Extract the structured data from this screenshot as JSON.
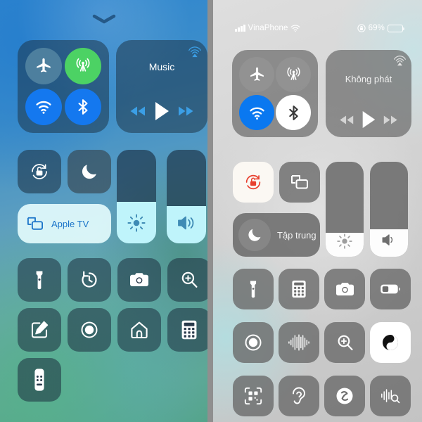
{
  "left_panel": {
    "name": "ios-control-center-light-wallpaper",
    "handle": {
      "icon": "chevron-down-icon"
    },
    "connectivity": {
      "airplane": {
        "label": "Airplane Mode",
        "icon": "airplane-icon",
        "state": "off",
        "color": "#4d7f9e"
      },
      "cellular": {
        "label": "Cellular Data",
        "icon": "cellular-icon",
        "state": "on",
        "color": "#4cd264"
      },
      "wifi": {
        "label": "Wi-Fi",
        "icon": "wifi-icon",
        "state": "on",
        "color": "#1478ef"
      },
      "bluetooth": {
        "label": "Bluetooth",
        "icon": "bluetooth-icon",
        "state": "on",
        "color": "#1478ef"
      }
    },
    "media": {
      "title": "Music",
      "airplay_icon": "airplay-audio-icon",
      "prev_icon": "rewind-icon",
      "play_icon": "play-icon",
      "next_icon": "fast-forward-icon",
      "accent": "#38a0e8"
    },
    "rotation_lock": {
      "label": "Rotation Lock",
      "icon": "rotation-lock-icon",
      "state": "off"
    },
    "do_not_disturb": {
      "label": "Do Not Disturb",
      "icon": "moon-icon",
      "state": "off"
    },
    "screen_mirroring": {
      "label": "Apple TV",
      "icon": "screen-mirroring-icon",
      "state": "on",
      "text_color": "#1a74c9"
    },
    "brightness": {
      "label": "Brightness",
      "icon": "brightness-icon",
      "value_percent": 44
    },
    "volume": {
      "label": "Volume",
      "icon": "speaker-icon",
      "value_percent": 40
    },
    "shortcuts": [
      {
        "label": "Flashlight",
        "icon": "flashlight-icon"
      },
      {
        "label": "Timer",
        "icon": "timer-icon"
      },
      {
        "label": "Camera",
        "icon": "camera-icon"
      },
      {
        "label": "Magnifier",
        "icon": "magnifier-icon"
      },
      {
        "label": "Notes",
        "icon": "notes-icon"
      },
      {
        "label": "Screen Recording",
        "icon": "screen-record-icon"
      },
      {
        "label": "Home",
        "icon": "home-icon"
      },
      {
        "label": "Calculator",
        "icon": "calculator-icon"
      },
      {
        "label": "Apple TV Remote",
        "icon": "remote-icon"
      }
    ]
  },
  "right_panel": {
    "name": "ios-control-center-dark-wallpaper",
    "status_bar": {
      "signal_icon": "signal-bars-icon",
      "carrier": "VinaPhone",
      "wifi_icon": "wifi-icon",
      "lock_icon": "rotation-lock-status-icon",
      "battery_percent": "69%",
      "battery_icon": "battery-icon",
      "battery_fill": 69
    },
    "connectivity": {
      "airplane": {
        "label": "Airplane Mode",
        "icon": "airplane-icon",
        "state": "off",
        "color": "#8b8b8b"
      },
      "cellular": {
        "label": "Cellular Data",
        "icon": "cellular-icon",
        "state": "off",
        "color": "#8b8b8b"
      },
      "wifi": {
        "label": "Wi-Fi",
        "icon": "wifi-icon",
        "state": "on",
        "color": "#0a78f0"
      },
      "bluetooth": {
        "label": "Bluetooth",
        "icon": "bluetooth-icon",
        "state": "on",
        "color": "#ffffff"
      }
    },
    "media": {
      "title": "Không phát",
      "airplay_icon": "airplay-audio-icon",
      "prev_icon": "rewind-icon",
      "play_icon": "play-icon",
      "next_icon": "fast-forward-icon",
      "accent": "#d6d6d6"
    },
    "rotation_lock": {
      "label": "Rotation Lock",
      "icon": "rotation-lock-icon",
      "state": "on",
      "color": "#e8402f"
    },
    "screen_mirroring": {
      "label": "Screen Mirroring",
      "icon": "screen-mirroring-icon",
      "state": "off"
    },
    "focus": {
      "label": "Tập trung",
      "icon": "moon-icon",
      "state": "off"
    },
    "brightness": {
      "label": "Brightness",
      "icon": "brightness-icon",
      "value_percent": 25
    },
    "volume": {
      "label": "Volume",
      "icon": "speaker-icon",
      "value_percent": 29
    },
    "shortcuts": [
      {
        "label": "Flashlight",
        "icon": "flashlight-icon",
        "state": "off"
      },
      {
        "label": "Calculator",
        "icon": "calculator-icon",
        "state": "off"
      },
      {
        "label": "Camera",
        "icon": "camera-icon",
        "state": "off"
      },
      {
        "label": "Low Power Mode",
        "icon": "low-power-battery-icon",
        "state": "off"
      },
      {
        "label": "Screen Recording",
        "icon": "screen-record-icon",
        "state": "off"
      },
      {
        "label": "Voice Memos",
        "icon": "waveform-icon",
        "state": "off"
      },
      {
        "label": "Magnifier",
        "icon": "magnifier-icon",
        "state": "off"
      },
      {
        "label": "Dark Mode",
        "icon": "dark-mode-icon",
        "state": "on"
      },
      {
        "label": "Code Scanner",
        "icon": "qr-scanner-icon",
        "state": "off"
      },
      {
        "label": "Hearing",
        "icon": "ear-icon",
        "state": "off"
      },
      {
        "label": "Shazam",
        "icon": "shazam-icon",
        "state": "off"
      },
      {
        "label": "Sound Recognition",
        "icon": "sound-recognition-icon",
        "state": "off"
      }
    ]
  }
}
